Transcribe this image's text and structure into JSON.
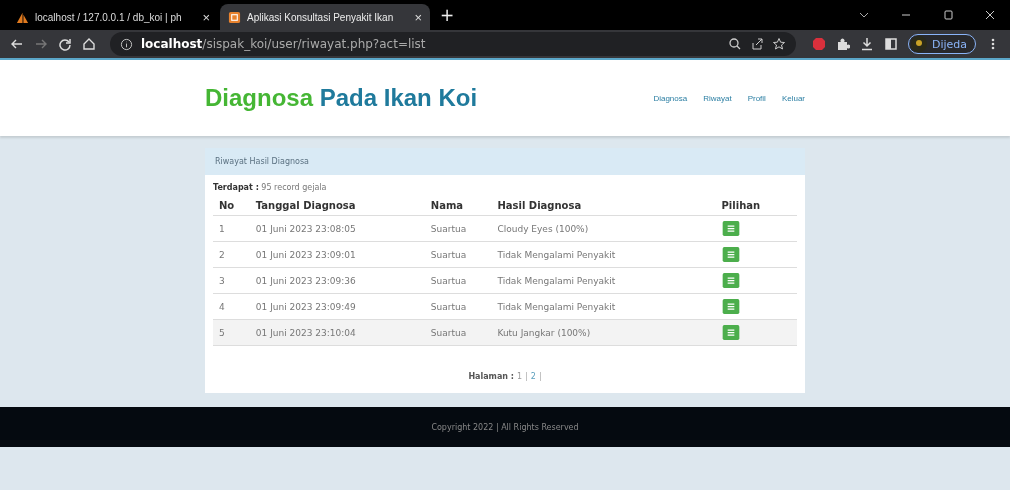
{
  "browser": {
    "tabs": [
      {
        "title": "localhost / 127.0.0.1 / db_koi | ph",
        "close": "×",
        "selected": false
      },
      {
        "title": "Aplikasi Konsultasi Penyakit Ikan",
        "close": "×",
        "selected": true
      }
    ],
    "new_tab": "+",
    "url_host": "localhost",
    "url_path": "/sispak_koi/user/riwayat.php?act=list",
    "profile": "Dijeda"
  },
  "header": {
    "brand_highlight": "Diagnosa",
    "brand_rest": "Pada Ikan Koi",
    "nav": [
      "Diagnosa",
      "Riwayat",
      "Profil",
      "Keluar"
    ]
  },
  "panel": {
    "title": "Riwayat Hasil Diagnosa",
    "count_label": "Terdapat :",
    "count_value": "95 record gejala",
    "columns": [
      "No",
      "Tanggal Diagnosa",
      "Nama",
      "Hasil Diagnosa",
      "Pilihan"
    ],
    "rows": [
      {
        "no": "1",
        "date": "01 Juni 2023 23:08:05",
        "name": "Suartua",
        "result": "Cloudy Eyes (100%)",
        "highlighted": false
      },
      {
        "no": "2",
        "date": "01 Juni 2023 23:09:01",
        "name": "Suartua",
        "result": "Tidak Mengalami Penyakit",
        "highlighted": false
      },
      {
        "no": "3",
        "date": "01 Juni 2023 23:09:36",
        "name": "Suartua",
        "result": "Tidak Mengalami Penyakit",
        "highlighted": false
      },
      {
        "no": "4",
        "date": "01 Juni 2023 23:09:49",
        "name": "Suartua",
        "result": "Tidak Mengalami Penyakit",
        "highlighted": false
      },
      {
        "no": "5",
        "date": "01 Juni 2023 23:10:04",
        "name": "Suartua",
        "result": "Kutu Jangkar  (100%)",
        "highlighted": true
      }
    ],
    "pagination": {
      "label": "Halaman :",
      "pages": [
        {
          "label": "1",
          "selected": true
        },
        {
          "label": "2",
          "selected": false
        }
      ],
      "separator": "|"
    }
  },
  "footer": "Copyright 2022 | All Rights Reserved"
}
